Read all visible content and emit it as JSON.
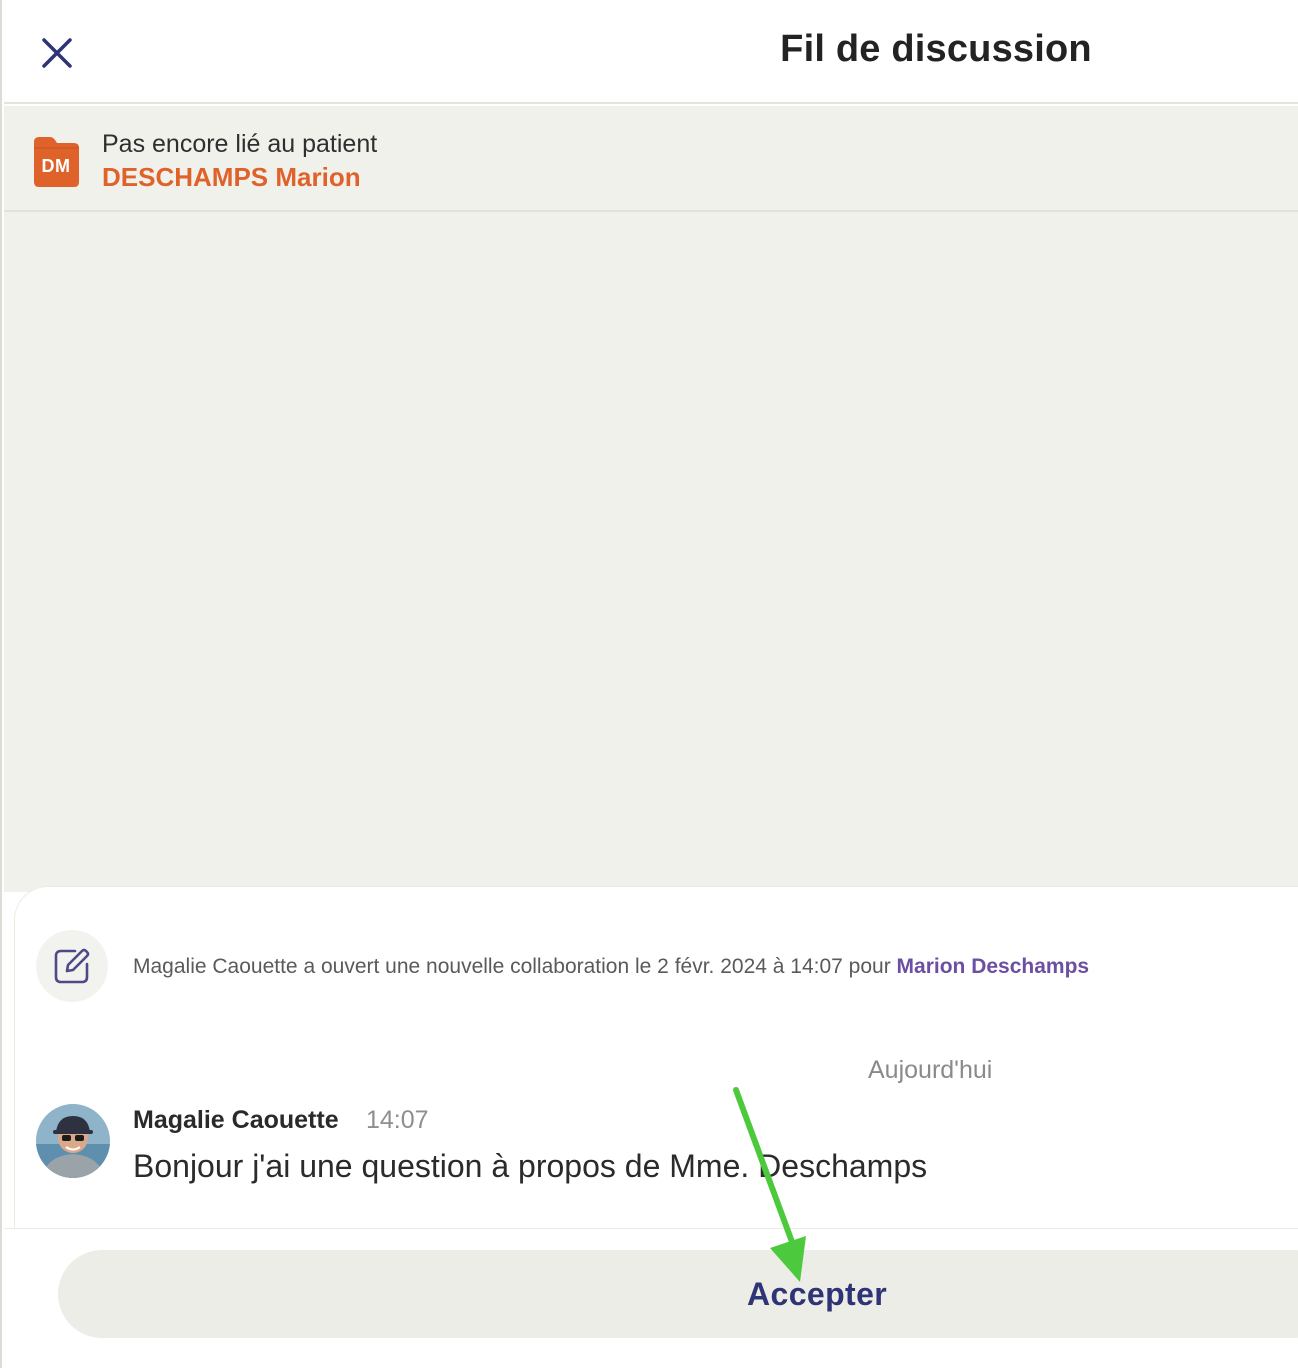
{
  "header": {
    "title": "Fil de discussion",
    "close_icon": "close-icon"
  },
  "patient": {
    "initials": "DM",
    "status": "Pas encore lié au patient",
    "name": "DESCHAMPS Marion",
    "accent_color": "#E0622B"
  },
  "thread": {
    "event": {
      "icon": "edit-icon",
      "text": "Magalie Caouette a ouvert une nouvelle collaboration le 2 févr. 2024 à 14:07 pour ",
      "link": "Marion Deschamps"
    },
    "date_separator": "Aujourd'hui",
    "messages": [
      {
        "author": "Magalie Caouette",
        "time": "14:07",
        "text": "Bonjour j'ai une question à propos de Mme. Deschamps"
      }
    ]
  },
  "footer": {
    "accept_label": "Accepter",
    "accent_color": "#2E3475"
  },
  "annotation": {
    "type": "arrow",
    "color": "#4CC93C"
  }
}
